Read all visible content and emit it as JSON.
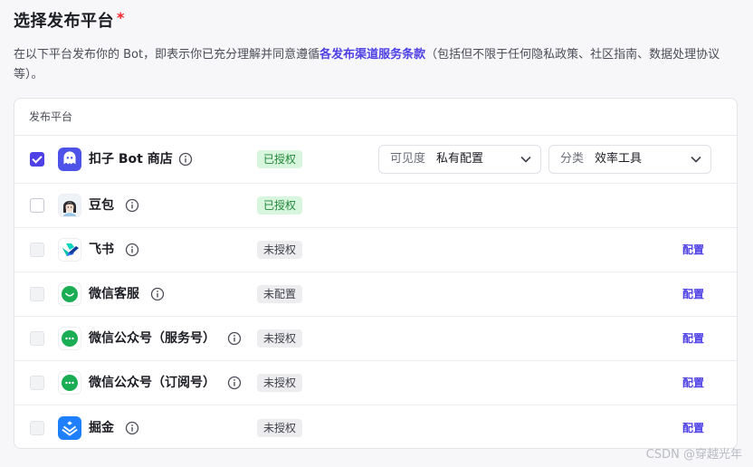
{
  "title": "选择发布平台",
  "required_mark": "*",
  "description": {
    "before": "在以下平台发布你的 Bot，即表示你已充分理解并同意遵循",
    "link": "各发布渠道服务条款",
    "after": "（包括但不限于任何隐私政策、社区指南、数据处理协议等）。"
  },
  "table": {
    "header": "发布平台",
    "rows": [
      {
        "name": "扣子 Bot 商店",
        "status": "已授权",
        "checked": true
      },
      {
        "name": "豆包",
        "status": "已授权",
        "checked": false
      },
      {
        "name": "飞书",
        "status": "未授权",
        "action": "配置"
      },
      {
        "name": "微信客服",
        "status": "未配置",
        "action": "配置"
      },
      {
        "name": "微信公众号（服务号）",
        "status": "未授权",
        "action": "配置"
      },
      {
        "name": "微信公众号（订阅号）",
        "status": "未授权",
        "action": "配置"
      },
      {
        "name": "掘金",
        "status": "未授权",
        "action": "配置"
      }
    ]
  },
  "visibility_select": {
    "label": "可见度",
    "value": "私有配置"
  },
  "category_select": {
    "label": "分类",
    "value": "效率工具"
  },
  "watermark": "CSDN @穿越光年",
  "colors": {
    "accent": "#4e40e5",
    "authorized_bg": "#d8f5dd",
    "authorized_text": "#22863a",
    "required": "#f5222d"
  }
}
